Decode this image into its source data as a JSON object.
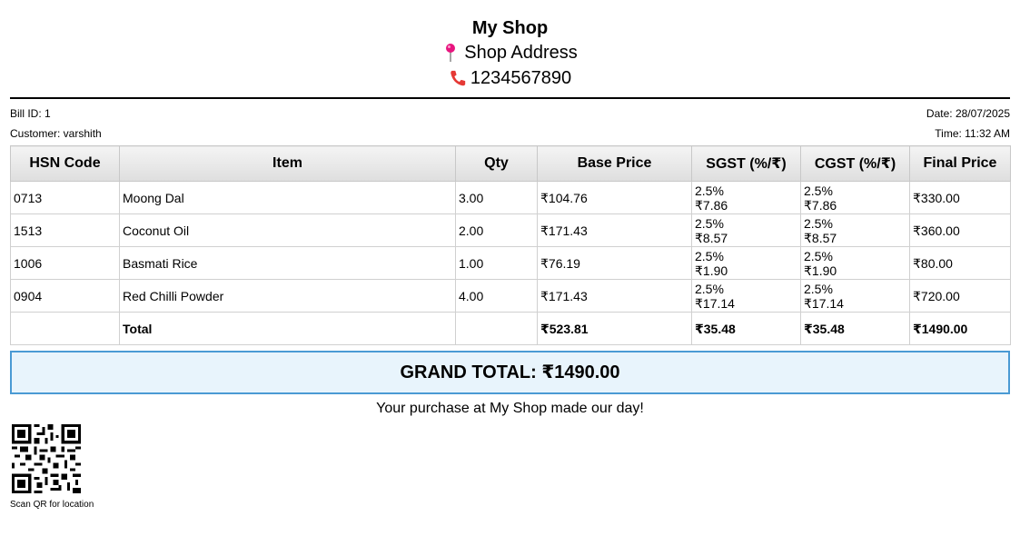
{
  "header": {
    "shop_name": "My Shop",
    "address": "Shop Address",
    "phone": "1234567890"
  },
  "bill": {
    "bill_id": "Bill ID: 1",
    "customer": "Customer: varshith",
    "date": "Date: 28/07/2025",
    "time": "Time: 11:32 AM"
  },
  "table": {
    "headers": [
      "HSN Code",
      "Item",
      "Qty",
      "Base Price",
      "SGST (%/₹)",
      "CGST (%/₹)",
      "Final Price"
    ],
    "rows": [
      {
        "hsn": "0713",
        "item": "Moong Dal",
        "qty": "3.00",
        "base": "₹104.76",
        "sgst_pct": "2.5%",
        "sgst_amt": "₹7.86",
        "cgst_pct": "2.5%",
        "cgst_amt": "₹7.86",
        "final": "₹330.00"
      },
      {
        "hsn": "1513",
        "item": "Coconut Oil",
        "qty": "2.00",
        "base": "₹171.43",
        "sgst_pct": "2.5%",
        "sgst_amt": "₹8.57",
        "cgst_pct": "2.5%",
        "cgst_amt": "₹8.57",
        "final": "₹360.00"
      },
      {
        "hsn": "1006",
        "item": "Basmati Rice",
        "qty": "1.00",
        "base": "₹76.19",
        "sgst_pct": "2.5%",
        "sgst_amt": "₹1.90",
        "cgst_pct": "2.5%",
        "cgst_amt": "₹1.90",
        "final": "₹80.00"
      },
      {
        "hsn": "0904",
        "item": "Red Chilli Powder",
        "qty": "4.00",
        "base": "₹171.43",
        "sgst_pct": "2.5%",
        "sgst_amt": "₹17.14",
        "cgst_pct": "2.5%",
        "cgst_amt": "₹17.14",
        "final": "₹720.00"
      }
    ],
    "total": {
      "label": "Total",
      "base": "₹523.81",
      "sgst": "₹35.48",
      "cgst": "₹35.48",
      "final": "₹1490.00"
    }
  },
  "grand_total": "GRAND TOTAL: ₹1490.00",
  "thanks": "Your purchase at My Shop made our day!",
  "qr": {
    "icon": "qr-code-icon",
    "caption": "Scan QR for location"
  },
  "icons": {
    "address": "pin-icon",
    "phone": "phone-icon"
  },
  "colors": {
    "pin": "#e8157f",
    "phone": "#e53935",
    "grand_border": "#4a9ad4",
    "grand_bg": "#e8f4fc"
  }
}
